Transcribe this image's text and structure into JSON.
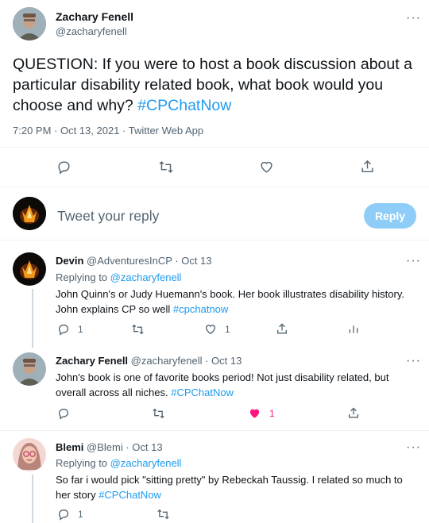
{
  "main_tweet": {
    "name": "Zachary Fenell",
    "handle": "@zacharyfenell",
    "text_before": "QUESTION: If you were to host a book discussion about a particular disability related book, what book would you choose and why? ",
    "hashtag": "#CPChatNow",
    "time": "7:20 PM · Oct 13, 2021 · Twitter Web App"
  },
  "composer": {
    "placeholder": "Tweet your reply",
    "button": "Reply"
  },
  "replies": [
    {
      "name": "Devin",
      "handle": "@AdventuresInCP",
      "date": "· Oct 13",
      "replying_to_label": "Replying to ",
      "replying_to": "@zacharyfenell",
      "text_before": "John Quinn's or Judy Huemann's book. Her book illustrates disability history. John explains CP so well ",
      "hashtag": "#cpchatnow",
      "reply_count": "1",
      "like_count": "1"
    },
    {
      "name": "Zachary Fenell",
      "handle": "@zacharyfenell",
      "date": "· Oct 13",
      "text_before": "John's book is one of favorite books period! Not just disability related, but overall across all niches. ",
      "hashtag": "#CPChatNow",
      "like_count": "1"
    },
    {
      "name": "Blemi",
      "handle": "@Blemi",
      "date": "· Oct 13",
      "replying_to_label": "Replying to ",
      "replying_to": "@zacharyfenell",
      "text_before": "So far i would pick \"sitting pretty\" by Rebeckah Taussig. I related so much to her story ",
      "hashtag": "#CPChatNow",
      "reply_count": "1"
    }
  ],
  "icons": {
    "reply": "reply-icon",
    "retweet": "retweet-icon",
    "like": "heart-icon",
    "share": "share-icon",
    "analytics": "analytics-icon",
    "more": "more-icon"
  },
  "colors": {
    "accent": "#1d9bf0",
    "reply_button_disabled": "#8ecdf8",
    "like_active": "#f91880",
    "muted": "#536471"
  }
}
